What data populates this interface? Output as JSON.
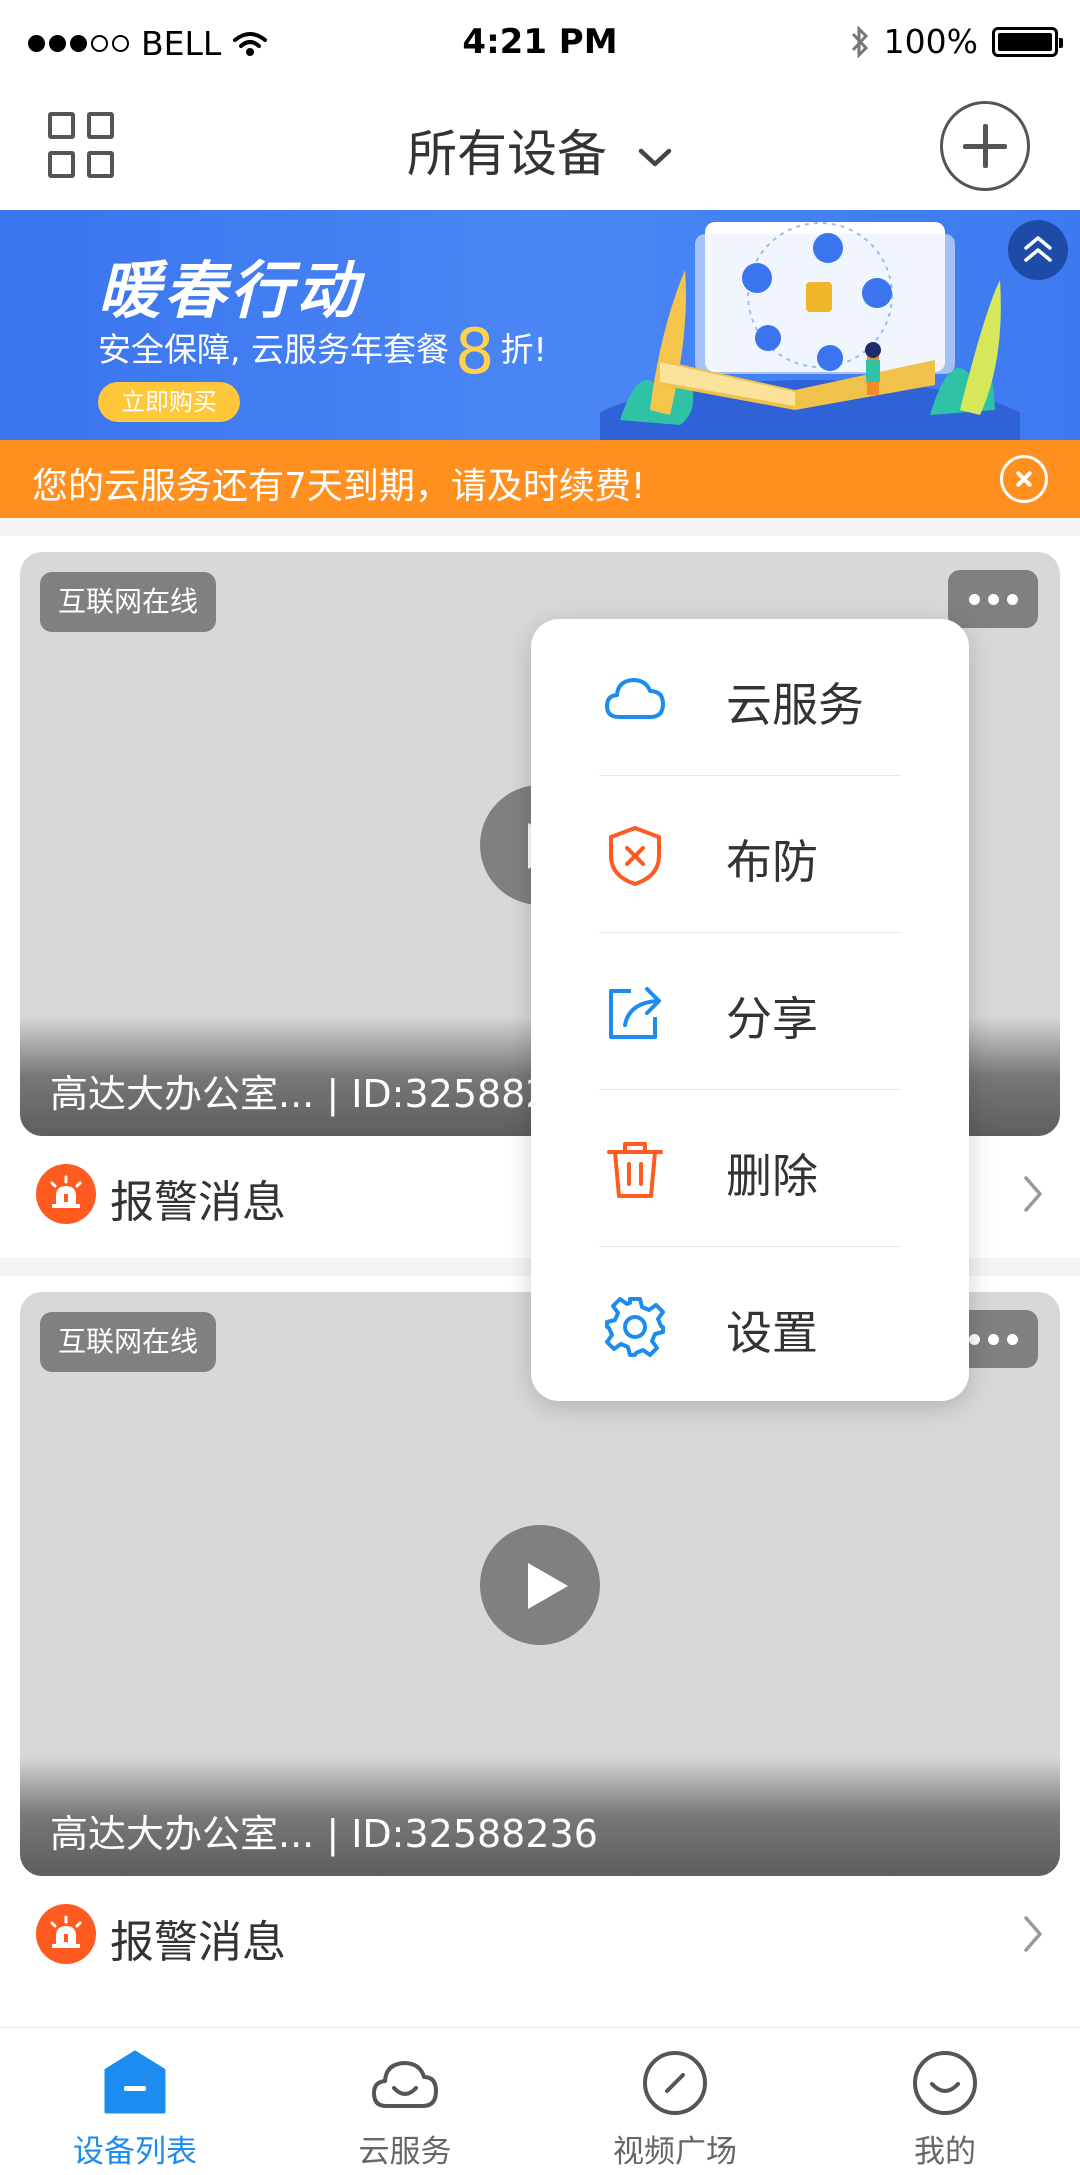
{
  "status_bar": {
    "carrier": "BELL",
    "time": "4:21 PM",
    "battery": "100%"
  },
  "header": {
    "title": "所有设备"
  },
  "banner": {
    "title": "暖春行动",
    "subtitle_prefix": "安全保障, 云服务年套餐",
    "discount": "8",
    "subtitle_suffix": "折!",
    "buy_button": "立即购买"
  },
  "notice": {
    "text": "您的云服务还有7天到期，请及时续费!"
  },
  "devices": [
    {
      "status": "互联网在线",
      "caption": "高达大办公室... | ID:325882",
      "alarm_label": "报警消息"
    },
    {
      "status": "互联网在线",
      "caption": "高达大办公室... | ID:32588236",
      "alarm_label": "报警消息"
    }
  ],
  "menu": {
    "items": [
      {
        "label": "云服务",
        "icon": "cloud-icon",
        "color": "#1d8cf0"
      },
      {
        "label": "布防",
        "icon": "shield-x-icon",
        "color": "#ff5a1f"
      },
      {
        "label": "分享",
        "icon": "share-icon",
        "color": "#1d8cf0"
      },
      {
        "label": "删除",
        "icon": "trash-icon",
        "color": "#ff5a1f"
      },
      {
        "label": "设置",
        "icon": "gear-icon",
        "color": "#1d8cf0"
      }
    ]
  },
  "tabs": [
    {
      "label": "设备列表",
      "icon": "home-icon",
      "active": true
    },
    {
      "label": "云服务",
      "icon": "cloud-smile-icon",
      "active": false
    },
    {
      "label": "视频广场",
      "icon": "compass-icon",
      "active": false
    },
    {
      "label": "我的",
      "icon": "smile-icon",
      "active": false
    }
  ],
  "colors": {
    "primary": "#1d8cf0",
    "warning": "#ff8f1f",
    "danger": "#ff5a1f",
    "banner": "#3a74ee"
  }
}
